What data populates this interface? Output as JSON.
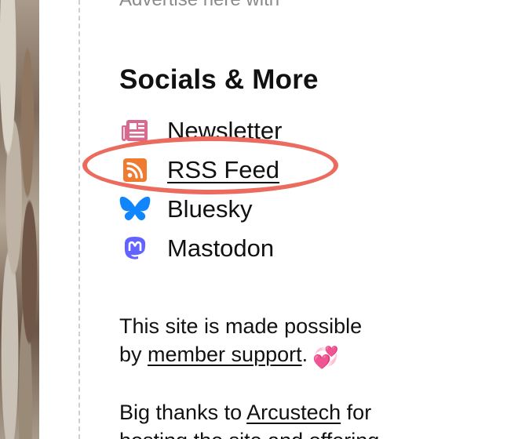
{
  "advertise": {
    "text": "Advertise here with"
  },
  "socials": {
    "heading": "Socials & More",
    "items": [
      {
        "label": "Newsletter",
        "icon": "newspaper-icon",
        "color": "#d96a8f"
      },
      {
        "label": "RSS Feed",
        "icon": "rss-icon",
        "color": "#ee7b2f"
      },
      {
        "label": "Bluesky",
        "icon": "butterfly-icon",
        "color": "#1185fe"
      },
      {
        "label": "Mastodon",
        "icon": "mastodon-icon",
        "color": "#6364ff"
      }
    ],
    "highlight_color": "#ec6b5f"
  },
  "support": {
    "line1": "This site is made possible",
    "line2_prefix": "by ",
    "link": "member support",
    "suffix": ".",
    "emoji": "💞"
  },
  "thanks": {
    "prefix": "Big thanks to ",
    "link": "Arcustech",
    "suffix": " for",
    "line2": "hosting the site and offering"
  }
}
